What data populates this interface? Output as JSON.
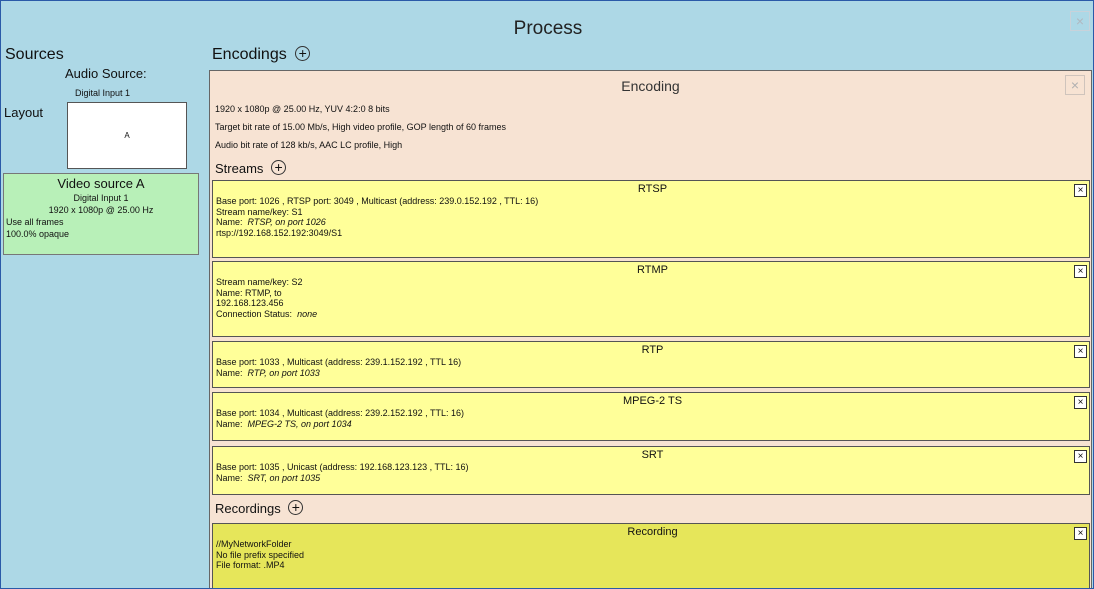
{
  "window": {
    "title": "Process",
    "close_glyph": "×"
  },
  "sources": {
    "heading": "Sources",
    "audio_label": "Audio Source:",
    "audio_value": "Digital Input 1",
    "layout_label": "Layout",
    "layout_preview_text": "A",
    "video_source": {
      "title": "Video source A",
      "input": "Digital Input 1",
      "format": "1920 x 1080p @ 25.00 Hz",
      "frames": "Use all frames",
      "opacity": "100.0% opaque"
    }
  },
  "encodings": {
    "heading": "Encodings",
    "plus_glyph": "+",
    "encoding": {
      "title": "Encoding",
      "close_glyph": "×",
      "lines": [
        "1920 x 1080p @ 25.00 Hz, YUV 4:2:0 8 bits",
        "Target bit rate of 15.00 Mb/s, High video profile, GOP length of 60 frames",
        "Audio bit rate of 128 kb/s,  AAC LC profile, High"
      ],
      "streams_heading": "Streams",
      "streams": [
        {
          "title": "RTSP",
          "lines": [
            "Base port: 1026 , RTSP port: 3049 , Multicast (address: 239.0.152.192 , TTL: 16)",
            "Stream name/key:  S1"
          ],
          "name_label": "Name:",
          "name_value": "RTSP, on port 1026",
          "extra": " rtsp://192.168.152.192:3049/S1"
        },
        {
          "title": "RTMP",
          "lines": [
            "Stream name/key:  S2",
            "Name:  RTMP, to",
            " 192.168.123.456"
          ],
          "status_label": "Connection Status:",
          "status_value": "none"
        },
        {
          "title": "RTP",
          "lines": [
            "Base port: 1033 , Multicast (address:  239.1.152.192 , TTL 16)"
          ],
          "name_label": "Name:",
          "name_value": "RTP, on port 1033"
        },
        {
          "title": "MPEG-2 TS",
          "lines": [
            "Base port: 1034 , Multicast (address: 239.2.152.192 , TTL: 16)"
          ],
          "name_label": "Name:",
          "name_value": "MPEG-2 TS, on port 1034"
        },
        {
          "title": "SRT",
          "lines": [
            "Base port: 1035 , Unicast (address: 192.168.123.123 , TTL: 16)"
          ],
          "name_label": "Name:",
          "name_value": "SRT, on port 1035"
        }
      ],
      "recordings_heading": "Recordings",
      "recording": {
        "title": "Recording",
        "lines": [
          "//MyNetworkFolder",
          "No file prefix specified",
          "File format: .MP4"
        ]
      }
    }
  },
  "stream_close_glyph": "×",
  "colors": {
    "background": "#add8e6",
    "encoding_panel": "#f7e3d3",
    "stream_card": "#ffff99",
    "recording_card": "#e6e65a",
    "video_source_card": "#b8f0b8"
  }
}
